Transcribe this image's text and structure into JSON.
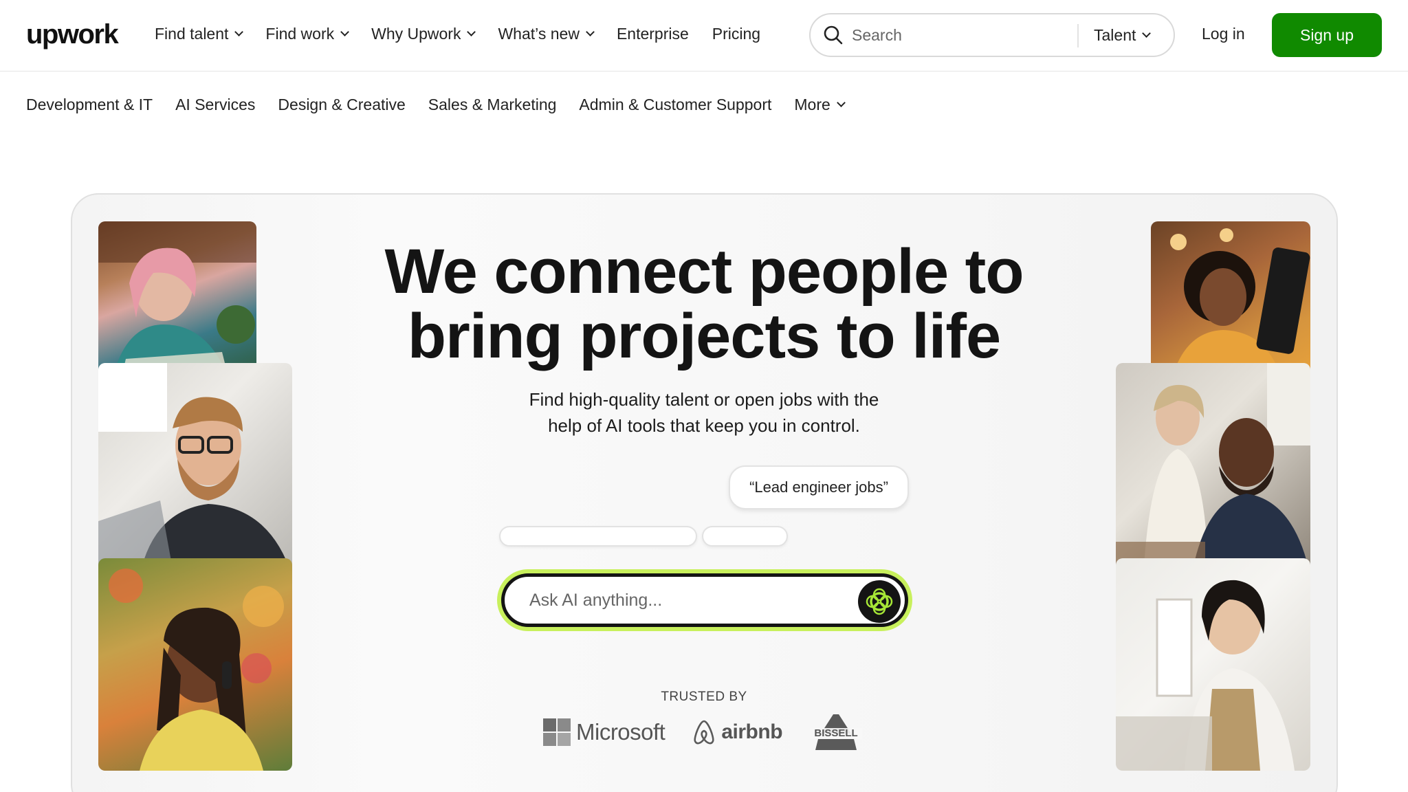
{
  "header": {
    "logo": "upwork",
    "nav": [
      {
        "label": "Find talent",
        "dropdown": true
      },
      {
        "label": "Find work",
        "dropdown": true
      },
      {
        "label": "Why Upwork",
        "dropdown": true
      },
      {
        "label": "What’s new",
        "dropdown": true
      },
      {
        "label": "Enterprise",
        "dropdown": false
      },
      {
        "label": "Pricing",
        "dropdown": false
      }
    ],
    "search": {
      "placeholder": "Search",
      "scope": "Talent"
    },
    "login": "Log in",
    "signup": "Sign up"
  },
  "categories": {
    "items": [
      "Development & IT",
      "AI Services",
      "Design & Creative",
      "Sales & Marketing",
      "Admin & Customer Support"
    ],
    "more": "More"
  },
  "hero": {
    "headline_line1": "We connect people to",
    "headline_line2": "bring projects to life",
    "subhead_line1": "Find high-quality talent or open jobs with the",
    "subhead_line2": "help of AI tools that keep you in control.",
    "suggestion": "“Lead engineer jobs”",
    "ai_placeholder": "Ask AI anything...",
    "trusted_label": "TRUSTED BY",
    "trusted_logos": [
      "Microsoft",
      "airbnb",
      "BISSELL"
    ]
  },
  "colors": {
    "brand_green": "#108a00",
    "ai_glow": "#c8f05c",
    "text": "#181818"
  }
}
